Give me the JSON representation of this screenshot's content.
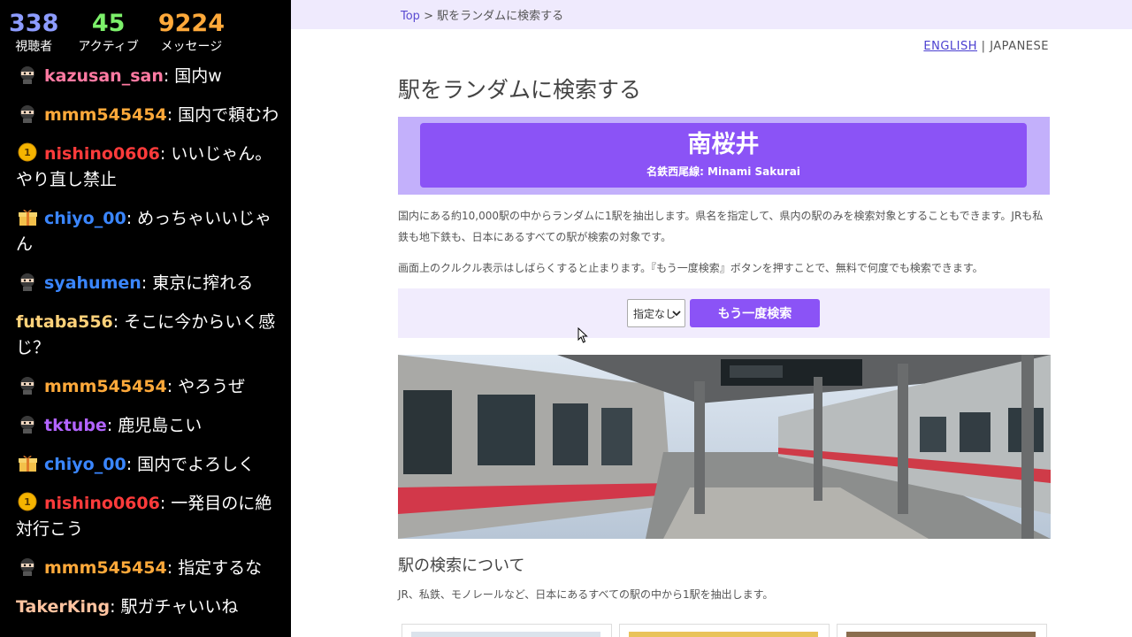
{
  "stream_stats": {
    "viewers": {
      "value": "338",
      "label": "視聴者",
      "color": "#8d9cff"
    },
    "active": {
      "value": "45",
      "label": "アクティブ",
      "color": "#7cf06a"
    },
    "messages": {
      "value": "9224",
      "label": "メッセージ",
      "color": "#ffa93a"
    }
  },
  "chat": [
    {
      "badge": "ninja-icon",
      "user": "kazusan_san",
      "user_color": "#ff7aa2",
      "text": ": 国内w"
    },
    {
      "badge": "ninja-icon",
      "user": "mmm545454",
      "user_color": "#ffa93a",
      "text": ": 国内で頼むわ"
    },
    {
      "badge": "coin-1-icon",
      "user": "nishino0606",
      "user_color": "#ff3b3b",
      "text": ": いいじゃん。やり直し禁止"
    },
    {
      "badge": "gift-box-icon",
      "user": "chiyo_00",
      "user_color": "#3a86ff",
      "text": ": めっちゃいいじゃん"
    },
    {
      "badge": "ninja-icon",
      "user": "syahumen",
      "user_color": "#3a86ff",
      "text": ": 東京に搾れる"
    },
    {
      "badge": "",
      "user": "futaba556",
      "user_color": "#ffd27a",
      "text": ": そこに今からいく感じ？"
    },
    {
      "badge": "ninja-icon",
      "user": "mmm545454",
      "user_color": "#ffa93a",
      "text": ": やろうぜ"
    },
    {
      "badge": "ninja-icon",
      "user": "tktube",
      "user_color": "#b264ff",
      "text": ": 鹿児島こい"
    },
    {
      "badge": "gift-box-icon",
      "user": "chiyo_00",
      "user_color": "#3a86ff",
      "text": ": 国内でよろしく"
    },
    {
      "badge": "coin-1-icon",
      "user": "nishino0606",
      "user_color": "#ff3b3b",
      "text": ": 一発目のに絶対行こう"
    },
    {
      "badge": "ninja-icon",
      "user": "mmm545454",
      "user_color": "#ffa93a",
      "text": ": 指定するな"
    },
    {
      "badge": "",
      "user": "TakerKing",
      "user_color": "#ffc3a0",
      "text": ": 駅ガチャいいね"
    }
  ],
  "page": {
    "breadcrumb": {
      "home": "Top",
      "separator": " > ",
      "current": "駅をランダムに検索する"
    },
    "lang": {
      "english": "ENGLISH",
      "separator": " | ",
      "japanese": "JAPANESE"
    },
    "title": "駅をランダムに検索する",
    "station": {
      "name": "南桜井",
      "line": "名鉄西尾線: Minami Sakurai"
    },
    "intro": "国内にある約10,000駅の中からランダムに1駅を抽出します。県名を指定して、県内の駅のみを検索対象とすることもできます。JRも私鉄も地下鉄も、日本にあるすべての駅が検索の対象です。",
    "note": "画面上のクルクル表示はしばらくすると止まります。『もう一度検索』ボタンを押すことで、無料で何度でも検索できます。",
    "search": {
      "select_value": "指定なし",
      "button_label": "もう一度検索"
    },
    "about_heading": "駅の検索について",
    "about_text": "JR、私鉄、モノレールなど、日本にあるすべての駅の中から1駅を抽出します。"
  },
  "colors": {
    "accent": "#8b53f6",
    "accent_light": "#c3b0fb",
    "panel": "#f1ecfd",
    "link": "#4a3fd0"
  }
}
